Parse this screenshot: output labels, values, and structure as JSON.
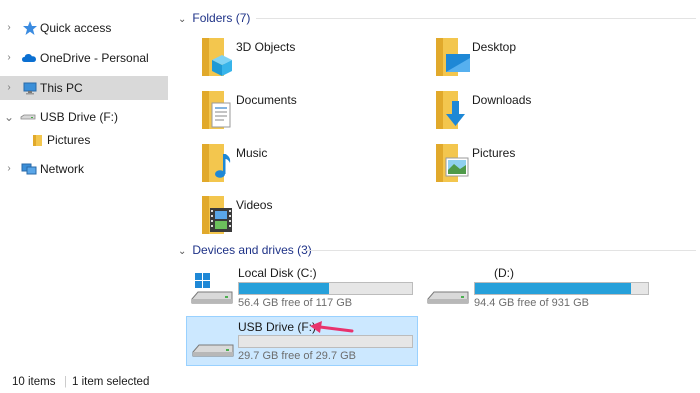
{
  "sidebar": {
    "items": [
      {
        "label": "Quick access",
        "icon": "star-icon",
        "chevron": "›",
        "selected": false
      },
      {
        "label": "OneDrive - Personal",
        "icon": "cloud-icon",
        "chevron": "›",
        "selected": false
      },
      {
        "label": "This PC",
        "icon": "computer-icon",
        "chevron": "›",
        "selected": true
      },
      {
        "label": "USB Drive (F:)",
        "icon": "usb-drive-icon",
        "chevron": "⌄",
        "selected": false
      },
      {
        "label": "Pictures",
        "icon": "folder-icon",
        "chevron": "",
        "selected": false
      },
      {
        "label": "Network",
        "icon": "network-icon",
        "chevron": "›",
        "selected": false
      }
    ]
  },
  "folders_group": {
    "header": "Folders (7)",
    "chevron": "⌄",
    "items": [
      {
        "label": "3D Objects",
        "icon": "3d-objects-folder-icon"
      },
      {
        "label": "Desktop",
        "icon": "desktop-folder-icon"
      },
      {
        "label": "Documents",
        "icon": "documents-folder-icon"
      },
      {
        "label": "Downloads",
        "icon": "downloads-folder-icon"
      },
      {
        "label": "Music",
        "icon": "music-folder-icon"
      },
      {
        "label": "Pictures",
        "icon": "pictures-folder-icon"
      },
      {
        "label": "Videos",
        "icon": "videos-folder-icon"
      }
    ]
  },
  "drives_group": {
    "header": "Devices and drives (3)",
    "chevron": "⌄",
    "items": [
      {
        "name": "Local Disk (C:)",
        "free": "56.4 GB free of 117 GB",
        "used_fraction": 0.52,
        "icon": "windows-drive-icon",
        "selected": false
      },
      {
        "name": "(D:)",
        "free": "94.4 GB free of 931 GB",
        "used_fraction": 0.9,
        "icon": "hard-drive-icon",
        "selected": false
      },
      {
        "name": "USB Drive (F:)",
        "free": "29.7 GB free of 29.7 GB",
        "used_fraction": 0.0,
        "icon": "usb-drive-icon",
        "selected": true
      }
    ]
  },
  "status_bar": {
    "item_count": "10 items",
    "selection": "1 item selected"
  },
  "colors": {
    "selection_bg": "#cce8ff",
    "selection_border": "#99d1ff",
    "bar_fill": "#26a0da",
    "header_text": "#1e3287",
    "arrow": "#e8336d"
  }
}
